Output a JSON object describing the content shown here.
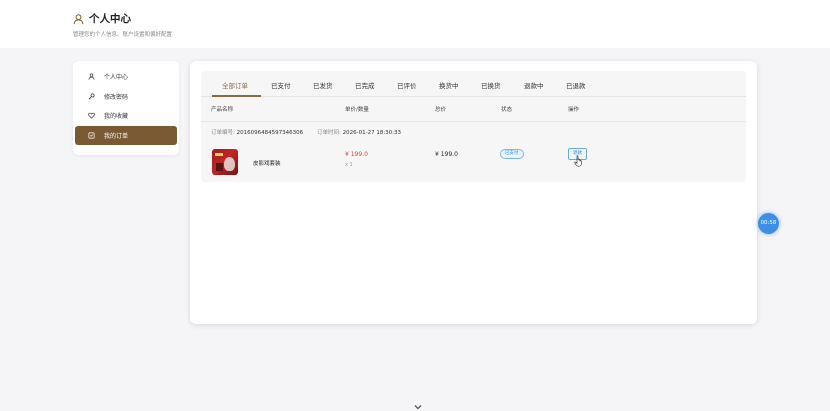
{
  "header": {
    "title": "个人中心",
    "subtitle": "管理您的个人信息、账户设置和偏好配置",
    "icon": "user-icon",
    "accent_color": "#8a6a3e"
  },
  "sidebar": {
    "items": [
      {
        "label": "个人中心",
        "icon": "user-icon",
        "active": false
      },
      {
        "label": "修改密码",
        "icon": "key-icon",
        "active": false
      },
      {
        "label": "我的收藏",
        "icon": "heart-icon",
        "active": false
      },
      {
        "label": "我的订单",
        "icon": "order-icon",
        "active": true
      }
    ],
    "active_color": "#7a5a32"
  },
  "orders": {
    "tabs": [
      "全部订单",
      "已支付",
      "已发货",
      "已完成",
      "已评价",
      "换货中",
      "已换货",
      "退款中",
      "已退款"
    ],
    "active_tab": 0,
    "columns": {
      "product": "产品名称",
      "price_qty": "单价/数量",
      "total": "总价",
      "status": "状态",
      "action": "操作"
    },
    "order": {
      "number_label": "订单编号:",
      "number": "2016096484597346306",
      "time_label": "订单时间:",
      "time": "2026-01-27 18:30:33",
      "product_name": "皮影戏套装",
      "unit_price": "¥ 199.0",
      "quantity": "x 1",
      "total": "¥ 199.0",
      "status": "已支付",
      "status_color": "#3a8adf",
      "action_label": "退款"
    }
  },
  "timer": {
    "text": "00:58",
    "color": "#3e8ee8"
  }
}
